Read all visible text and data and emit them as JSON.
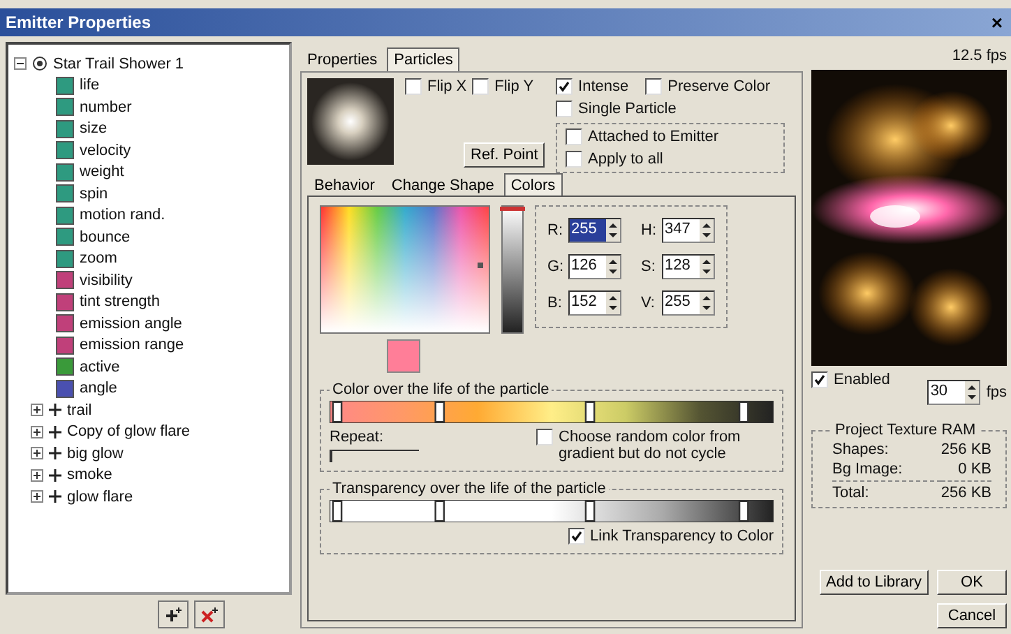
{
  "window": {
    "title": "Emitter Properties",
    "close": "×"
  },
  "tree": {
    "root": {
      "label": "Star Trail Shower 1",
      "expanded": true,
      "children": [
        {
          "label": "life",
          "color": "#2e9a80"
        },
        {
          "label": "number",
          "color": "#2e9a80"
        },
        {
          "label": "size",
          "color": "#2e9a80"
        },
        {
          "label": "velocity",
          "color": "#2e9a80"
        },
        {
          "label": "weight",
          "color": "#2e9a80"
        },
        {
          "label": "spin",
          "color": "#2e9a80"
        },
        {
          "label": "motion rand.",
          "color": "#2e9a80"
        },
        {
          "label": "bounce",
          "color": "#2e9a80"
        },
        {
          "label": "zoom",
          "color": "#2e9a80"
        },
        {
          "label": "visibility",
          "color": "#c0407a"
        },
        {
          "label": "tint strength",
          "color": "#c0407a"
        },
        {
          "label": "emission angle",
          "color": "#c0407a"
        },
        {
          "label": "emission range",
          "color": "#c0407a"
        },
        {
          "label": "active",
          "color": "#3a9a3a"
        },
        {
          "label": "angle",
          "color": "#4a50b0"
        }
      ]
    },
    "siblings": [
      {
        "label": "trail",
        "expanded": false
      },
      {
        "label": "Copy of glow flare",
        "expanded": false
      },
      {
        "label": "big glow",
        "expanded": false
      },
      {
        "label": "smoke",
        "expanded": false
      },
      {
        "label": "glow flare",
        "expanded": false
      }
    ]
  },
  "tabs": [
    {
      "label": "Properties",
      "selected": false
    },
    {
      "label": "Particles",
      "selected": true
    }
  ],
  "flips": [
    {
      "label": "Flip X",
      "checked": false
    },
    {
      "label": "Flip Y",
      "checked": false
    }
  ],
  "options": [
    {
      "label": "Intense",
      "checked": true
    },
    {
      "label": "Preserve Color",
      "checked": false
    },
    {
      "label": "Single Particle",
      "checked": false
    }
  ],
  "attach_options": [
    {
      "label": "Attached to Emitter",
      "checked": false
    },
    {
      "label": "Apply to all",
      "checked": false
    }
  ],
  "ref_point": "Ref. Point",
  "subtabs": [
    {
      "label": "Behavior",
      "selected": false
    },
    {
      "label": "Change Shape",
      "selected": false
    },
    {
      "label": "Colors",
      "selected": true
    }
  ],
  "brightness": {
    "level": 1
  },
  "color_fields": [
    {
      "label": "R:",
      "value": "255",
      "selected": true
    },
    {
      "label": "H:",
      "value": "347",
      "selected": false
    },
    {
      "label": "G:",
      "value": "126",
      "selected": false
    },
    {
      "label": "S:",
      "value": "128",
      "selected": false
    },
    {
      "label": "B:",
      "value": "152",
      "selected": false
    },
    {
      "label": "V:",
      "value": "255",
      "selected": false
    }
  ],
  "color_gradient": {
    "title": "Color over the life of the particle",
    "repeat_label": "Repeat:",
    "repeat": {
      "level": 0
    },
    "random": {
      "label": "Choose random color from gradient but do not cycle",
      "checked": false
    }
  },
  "transparency": {
    "title": "Transparency over the life of the particle",
    "link": {
      "label": "Link Transparency to Color",
      "checked": true
    }
  },
  "preview": {
    "fps": "12.5 fps",
    "enabled": {
      "label": "Enabled",
      "checked": true
    },
    "rate": "30",
    "rate_unit": "fps"
  },
  "texture_ram": {
    "title": "Project Texture RAM",
    "rows": [
      {
        "label": "Shapes:",
        "value": "256 KB"
      },
      {
        "label": "Bg Image:",
        "value": "0 KB"
      }
    ],
    "total": {
      "label": "Total:",
      "value": "256 KB"
    }
  },
  "buttons": {
    "add": "Add to Library",
    "ok": "OK",
    "cancel": "Cancel"
  }
}
